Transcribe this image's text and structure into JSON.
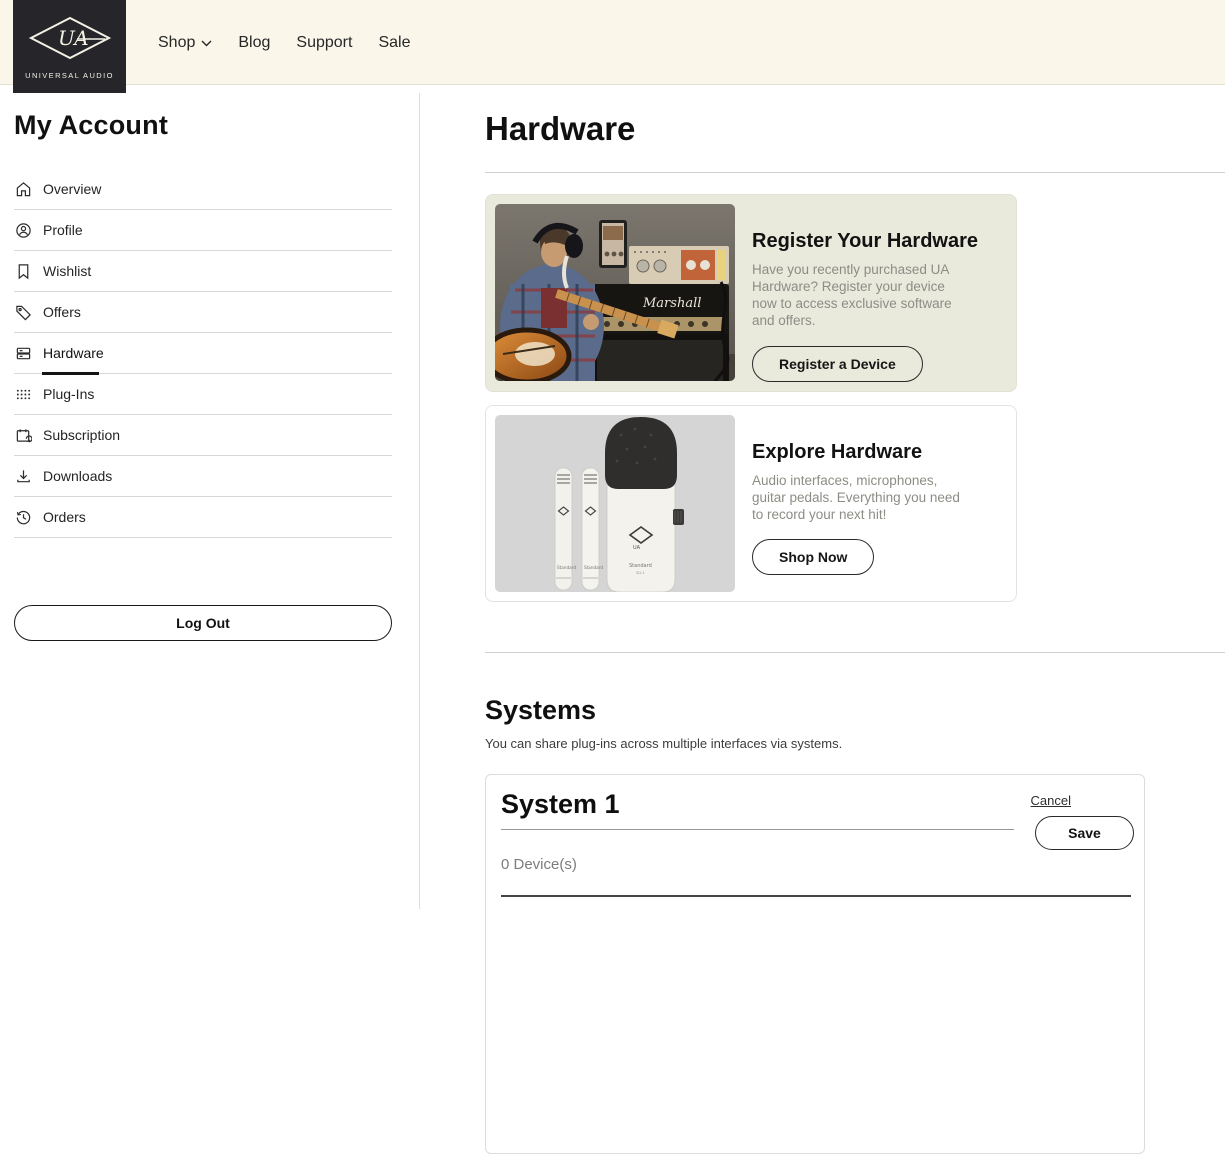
{
  "brand": {
    "logo_text": "UNIVERSAL AUDIO",
    "logo_monogram": "UA"
  },
  "nav": {
    "items": [
      {
        "label": "Shop",
        "has_dropdown": true
      },
      {
        "label": "Blog",
        "has_dropdown": false
      },
      {
        "label": "Support",
        "has_dropdown": false
      },
      {
        "label": "Sale",
        "has_dropdown": false
      }
    ]
  },
  "sidebar": {
    "title": "My Account",
    "items": [
      {
        "label": "Overview",
        "icon": "home-icon",
        "active": false
      },
      {
        "label": "Profile",
        "icon": "profile-icon",
        "active": false
      },
      {
        "label": "Wishlist",
        "icon": "bookmark-icon",
        "active": false
      },
      {
        "label": "Offers",
        "icon": "tag-icon",
        "active": false
      },
      {
        "label": "Hardware",
        "icon": "hardware-rack-icon",
        "active": true
      },
      {
        "label": "Plug-Ins",
        "icon": "plugins-dot-grid-icon",
        "active": false
      },
      {
        "label": "Subscription",
        "icon": "subscription-calendar-icon",
        "active": false
      },
      {
        "label": "Downloads",
        "icon": "download-icon",
        "active": false
      },
      {
        "label": "Orders",
        "icon": "orders-history-icon",
        "active": false
      }
    ],
    "logout_label": "Log Out"
  },
  "main": {
    "title": "Hardware",
    "cards": [
      {
        "title": "Register Your Hardware",
        "body": "Have you recently purchased UA Hardware? Register your device now to access exclusive software and offers.",
        "button": "Register a Device",
        "image": "guitarist-with-marshall-amp-photo"
      },
      {
        "title": "Explore Hardware",
        "body": "Audio interfaces, microphones, guitar pedals. Everything you need to record your next hit!",
        "button": "Shop Now",
        "image": "ua-standard-microphones-photo"
      }
    ],
    "systems": {
      "title": "Systems",
      "description": "You can share plug-ins across multiple interfaces via systems.",
      "system": {
        "name": "System 1",
        "device_count": "0 Device(s)",
        "cancel_label": "Cancel",
        "save_label": "Save"
      }
    }
  },
  "colors": {
    "nav_background": "#faf6ea",
    "logo_background": "#26262a",
    "register_card_background": "#e9e9dc",
    "mic_image_background": "#d5d5d5",
    "text_dark": "#1a1a1a",
    "text_muted": "#8d8d86",
    "divider": "#cfcfcf"
  }
}
